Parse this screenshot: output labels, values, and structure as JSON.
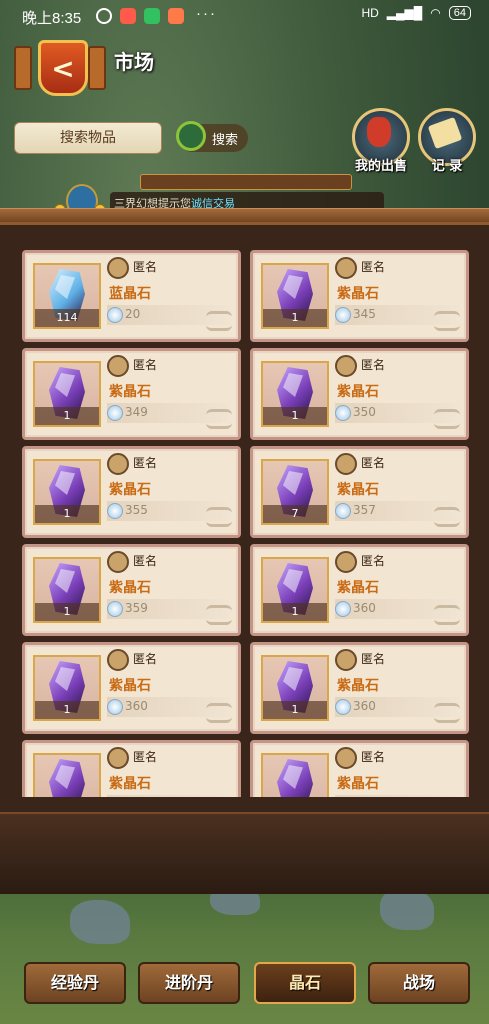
{
  "status_bar": {
    "time": "晚上8:35",
    "dots": "···",
    "battery": "64",
    "network": "HD"
  },
  "header": {
    "back_glyph": "<",
    "title": "市场"
  },
  "search": {
    "placeholder": "搜索物品",
    "button_label": "搜索"
  },
  "actions": {
    "my_sales": "我的出售",
    "records": "记 录"
  },
  "notice": {
    "prefix": "三界幻想提示您",
    "highlight": "诚信交易"
  },
  "listings": [
    {
      "seller": "匿名",
      "name": "蓝晶石",
      "count": "114",
      "price": "20",
      "gem": "blue"
    },
    {
      "seller": "匿名",
      "name": "紫晶石",
      "count": "1",
      "price": "345",
      "gem": "purple"
    },
    {
      "seller": "匿名",
      "name": "紫晶石",
      "count": "1",
      "price": "349",
      "gem": "purple"
    },
    {
      "seller": "匿名",
      "name": "紫晶石",
      "count": "1",
      "price": "350",
      "gem": "purple"
    },
    {
      "seller": "匿名",
      "name": "紫晶石",
      "count": "1",
      "price": "355",
      "gem": "purple"
    },
    {
      "seller": "匿名",
      "name": "紫晶石",
      "count": "7",
      "price": "357",
      "gem": "purple"
    },
    {
      "seller": "匿名",
      "name": "紫晶石",
      "count": "1",
      "price": "359",
      "gem": "purple"
    },
    {
      "seller": "匿名",
      "name": "紫晶石",
      "count": "1",
      "price": "360",
      "gem": "purple"
    },
    {
      "seller": "匿名",
      "name": "紫晶石",
      "count": "1",
      "price": "360",
      "gem": "purple"
    },
    {
      "seller": "匿名",
      "name": "紫晶石",
      "count": "1",
      "price": "360",
      "gem": "purple"
    },
    {
      "seller": "匿名",
      "name": "紫晶石",
      "count": "",
      "price": "",
      "gem": "purple"
    },
    {
      "seller": "匿名",
      "name": "紫晶石",
      "count": "",
      "price": "",
      "gem": "purple"
    }
  ],
  "tabs": [
    {
      "label": "经验丹",
      "active": false
    },
    {
      "label": "进阶丹",
      "active": false
    },
    {
      "label": "晶石",
      "active": true
    },
    {
      "label": "战场",
      "active": false
    }
  ],
  "colors": {
    "blue_gem": "#5fb0e6",
    "purple_gem": "#7a3fb8",
    "accent": "#c96a14",
    "highlight": "#6ce1ff"
  }
}
